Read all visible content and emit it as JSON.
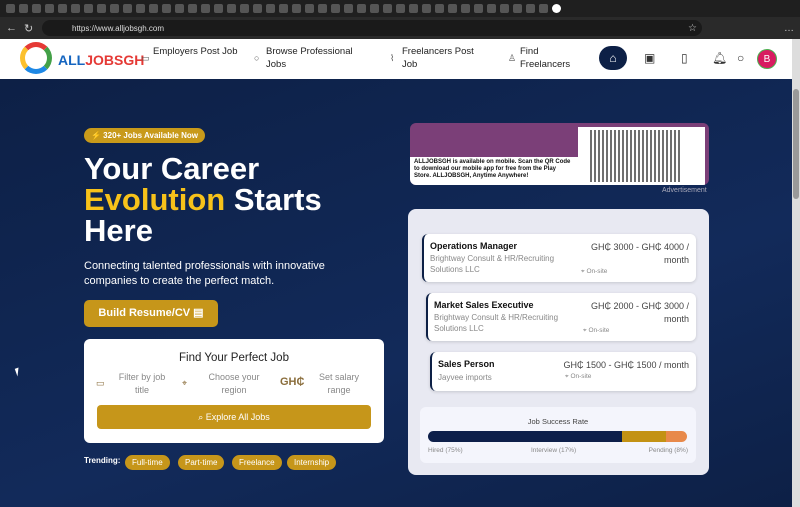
{
  "browser": {
    "url": "https://www.alljobsgh.com"
  },
  "nav": {
    "brand_a": "ALL",
    "brand_b": "JOBSGH",
    "links": [
      "Employers Post Job",
      "Browse Professional Jobs",
      "Freelancers Post Job",
      "Find Freelancers"
    ],
    "avatar": "B"
  },
  "hero": {
    "badge": "⚡ 320+ Jobs Available Now",
    "title1": "Your Career",
    "title2": "Evolution",
    "title3": "Starts",
    "title4": "Here",
    "subtitle": "Connecting talented professionals with innovative companies to create the perfect match.",
    "resume_button": "Build Resume/CV"
  },
  "find": {
    "title": "Find Your Perfect Job",
    "filters": [
      "Filter by job title",
      "Choose your region",
      "Set salary range"
    ],
    "currency": "GH₵",
    "explore": "Explore All Jobs"
  },
  "trending": {
    "label": "Trending:",
    "chips": [
      "Full-time",
      "Part-time",
      "Freelance",
      "Internship"
    ]
  },
  "ad": {
    "text": "ALLJOBSGH is available on mobile. Scan the QR Code to download our mobile app for free from the Play Store. ALLJOBSGH, Anytime Anywhere!",
    "label": "Advertisement"
  },
  "jobs": [
    {
      "title": "Operations Manager",
      "company": "Brightway Consult & HR/Recruiting Solutions LLC",
      "salary": "GH₵ 3000 - GH₵ 4000 / month",
      "location": "On-site"
    },
    {
      "title": "Market Sales Executive",
      "company": "Brightway Consult & HR/Recruiting Solutions LLC",
      "salary": "GH₵ 2000 - GH₵ 3000 / month",
      "location": "On-site"
    },
    {
      "title": "Sales Person",
      "company": "Jayvee imports",
      "salary": "GH₵ 1500 - GH₵ 1500 / month",
      "location": "On-site"
    }
  ],
  "success": {
    "title": "Job Success Rate",
    "segments": [
      {
        "label": "Hired (75%)",
        "value": 75,
        "color": "#0d1f4a"
      },
      {
        "label": "Interview (17%)",
        "value": 17,
        "color": "#c39214"
      },
      {
        "label": "Pending (8%)",
        "value": 8,
        "color": "#e8894a"
      }
    ]
  }
}
